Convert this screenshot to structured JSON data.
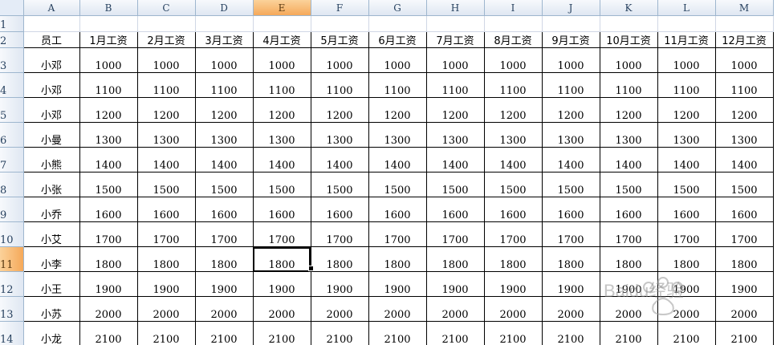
{
  "columns": [
    "A",
    "B",
    "C",
    "D",
    "E",
    "F",
    "G",
    "H",
    "I",
    "J",
    "K",
    "L",
    "M"
  ],
  "active_column": "E",
  "active_row": "11",
  "row_numbers": [
    "1",
    "2",
    "3",
    "4",
    "5",
    "6",
    "7",
    "8",
    "9",
    "10",
    "11",
    "12",
    "13",
    "14"
  ],
  "headers": [
    "员工",
    "1月工资",
    "2月工资",
    "3月工资",
    "4月工资",
    "5月工资",
    "6月工资",
    "7月工资",
    "8月工资",
    "9月工资",
    "10月工资",
    "11月工资",
    "12月工资"
  ],
  "rows": [
    {
      "name": "小邓",
      "value": "1000"
    },
    {
      "name": "小邓",
      "value": "1100"
    },
    {
      "name": "小邓",
      "value": "1200"
    },
    {
      "name": "小曼",
      "value": "1300"
    },
    {
      "name": "小熊",
      "value": "1400"
    },
    {
      "name": "小张",
      "value": "1500"
    },
    {
      "name": "小乔",
      "value": "1600"
    },
    {
      "name": "小艾",
      "value": "1700"
    },
    {
      "name": "小李",
      "value": "1800"
    },
    {
      "name": "小王",
      "value": "1900"
    },
    {
      "name": "小苏",
      "value": "2000"
    },
    {
      "name": "小龙",
      "value": "2100"
    }
  ],
  "watermark": "Baidu经验",
  "colors": {
    "header_bg": "#dfe7f2",
    "active_header": "#f5a95a",
    "grid": "#d0d7e5"
  }
}
